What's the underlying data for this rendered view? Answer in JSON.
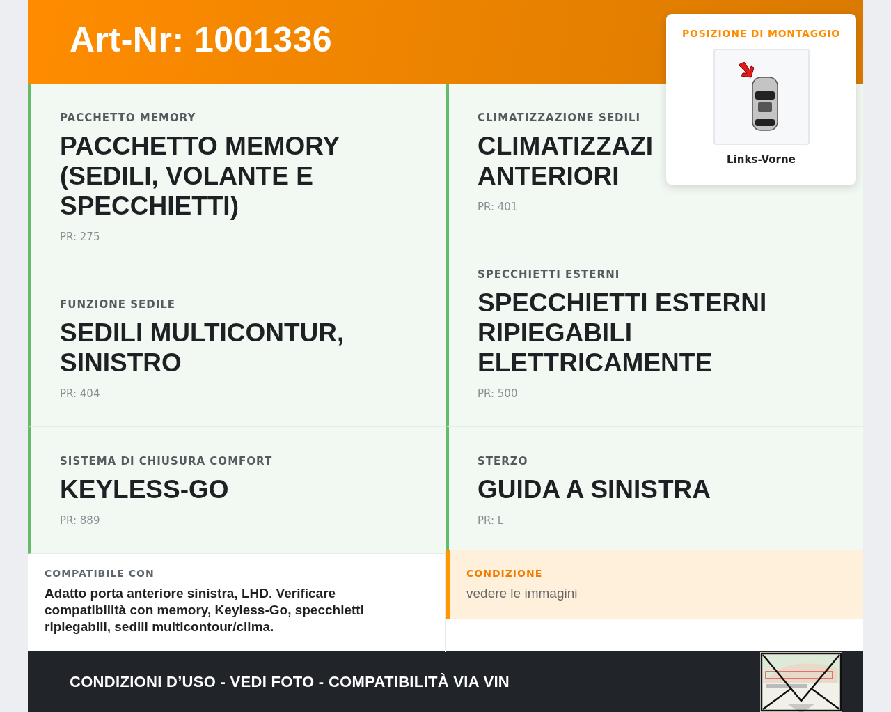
{
  "header": {
    "title": "Art-Nr: 1001336"
  },
  "mounting": {
    "heading": "POSIZIONE DI MONTAGGIO",
    "position": "Links-Vorne"
  },
  "columns": [
    [
      {
        "category": "PACCHETTO MEMORY",
        "value": "PACCHETTO MEMORY (SEDILI, VOLANTE E SPECCHIETTI)",
        "code": "PR: 275"
      },
      {
        "category": "FUNZIONE SEDILE",
        "value": "SEDILI MULTICONTUR, SINISTRO",
        "code": "PR: 404"
      },
      {
        "category": "SISTEMA DI CHIUSURA COMFORT",
        "value": "KEYLESS-GO",
        "code": "PR: 889"
      }
    ],
    [
      {
        "category": "CLIMATIZZAZIONE SEDILI",
        "value": "CLIMATIZZAZI\nANTERIORI",
        "code": "PR: 401"
      },
      {
        "category": "SPECCHIETTI ESTERNI",
        "value": "SPECCHIETTI ESTERNI RIPIEGABILI ELETTRICAMENTE",
        "code": "PR: 500"
      },
      {
        "category": "STERZO",
        "value": "GUIDA A SINISTRA",
        "code": "PR: L"
      }
    ]
  ],
  "compatibility": {
    "label": "COMPATIBILE CON",
    "text": "Adatto porta anteriore sinistra, LHD. Verificare compatibilità con memory, Keyless-Go, specchietti ripiegabili, sedili multicontour/clima."
  },
  "condition": {
    "label": "CONDIZIONE",
    "text": "vedere le immagini"
  },
  "footer": {
    "text": "CONDIZIONI D’USO - VEDI FOTO - COMPATIBILITÀ VIA VIN"
  }
}
